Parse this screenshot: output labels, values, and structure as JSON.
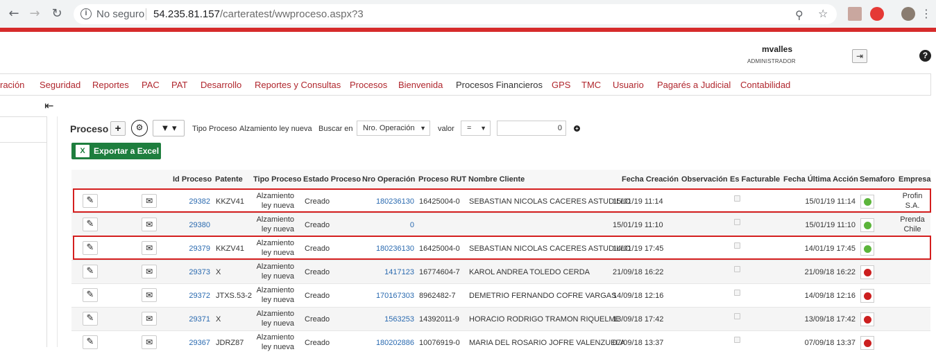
{
  "browser": {
    "insecure_label": "No seguro",
    "url_host": "54.235.81.157",
    "url_path": "/carteratest/wwproceso.aspx?3"
  },
  "user": {
    "name": "mvalles",
    "role": "ADMINISTRADOR"
  },
  "menu": [
    "ración",
    "Seguridad",
    "Reportes",
    "PAC",
    "PAT",
    "Desarrollo",
    "Reportes y Consultas",
    "Procesos",
    "Bienvenida",
    "Procesos Financieros",
    "GPS",
    "TMC",
    "Usuario",
    "Pagarés a Judicial",
    "Contabilidad"
  ],
  "filters": {
    "title": "Proceso",
    "tipo_proceso_label": "Tipo Proceso",
    "tipo_proceso_value": "Alzamiento ley nueva",
    "buscar_label": "Buscar en",
    "buscar_value": "Nro. Operación",
    "valor_label": "valor",
    "operator_value": "=",
    "valor_input": "0",
    "excel_label": "Exportar a Excel"
  },
  "columns": [
    "Id Proceso",
    "Patente",
    "Tipo Proceso",
    "Estado Proceso",
    "Nro Operación",
    "Proceso RUT",
    "Nombre Cliente",
    "Fecha Creación",
    "Observación",
    "Es Facturable",
    "Fecha Última Acción",
    "Semaforo",
    "Empresa"
  ],
  "rows": [
    {
      "id": "29382",
      "patente": "KKZV41",
      "tipo": "Alzamiento ley nueva",
      "estado": "Creado",
      "nro_op": "180236130",
      "rut": "16425004-0",
      "cliente": "SEBASTIAN NICOLAS CACERES ASTUDILLO",
      "creacion": "15/01/19 11:14",
      "ultima": "15/01/19 11:14",
      "semaforo": "#5cb53b",
      "empresa": "Profin S.A."
    },
    {
      "id": "29380",
      "patente": "",
      "tipo": "Alzamiento ley nueva",
      "estado": "Creado",
      "nro_op": "0",
      "rut": "",
      "cliente": "",
      "creacion": "15/01/19 11:10",
      "ultima": "15/01/19 11:10",
      "semaforo": "#5cb53b",
      "empresa": "Prenda Chile"
    },
    {
      "id": "29379",
      "patente": "KKZV41",
      "tipo": "Alzamiento ley nueva",
      "estado": "Creado",
      "nro_op": "180236130",
      "rut": "16425004-0",
      "cliente": "SEBASTIAN NICOLAS CACERES ASTUDILLO",
      "creacion": "14/01/19 17:45",
      "ultima": "14/01/19 17:45",
      "semaforo": "#5cb53b",
      "empresa": ""
    },
    {
      "id": "29373",
      "patente": "X",
      "tipo": "Alzamiento ley nueva",
      "estado": "Creado",
      "nro_op": "1417123",
      "rut": "16774604-7",
      "cliente": "KAROL ANDREA TOLEDO CERDA",
      "creacion": "21/09/18 16:22",
      "ultima": "21/09/18 16:22",
      "semaforo": "#cc1f1f",
      "empresa": ""
    },
    {
      "id": "29372",
      "patente": "JTXS.53-2",
      "tipo": "Alzamiento ley nueva",
      "estado": "Creado",
      "nro_op": "170167303",
      "rut": "8962482-7",
      "cliente": "DEMETRIO FERNANDO COFRE VARGAS",
      "creacion": "14/09/18 12:16",
      "ultima": "14/09/18 12:16",
      "semaforo": "#cc1f1f",
      "empresa": ""
    },
    {
      "id": "29371",
      "patente": "X",
      "tipo": "Alzamiento ley nueva",
      "estado": "Creado",
      "nro_op": "1563253",
      "rut": "14392011-9",
      "cliente": "HORACIO RODRIGO TRAMON RIQUELME",
      "creacion": "13/09/18 17:42",
      "ultima": "13/09/18 17:42",
      "semaforo": "#cc1f1f",
      "empresa": ""
    },
    {
      "id": "29367",
      "patente": "JDRZ87",
      "tipo": "Alzamiento ley nueva",
      "estado": "Creado",
      "nro_op": "180202886",
      "rut": "10076919-0",
      "cliente": "MARIA DEL ROSARIO JOFRE VALENZUELA",
      "creacion": "07/09/18 13:37",
      "ultima": "07/09/18 13:37",
      "semaforo": "#cc1f1f",
      "empresa": ""
    }
  ]
}
